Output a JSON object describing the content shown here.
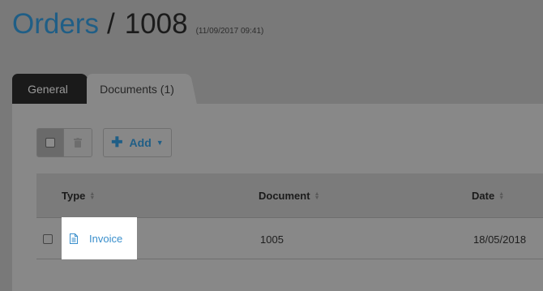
{
  "breadcrumb": {
    "parent": "Orders",
    "separator": "/",
    "current": "1008",
    "timestamp": "(11/09/2017 09:41)"
  },
  "tabs": [
    {
      "label": "General",
      "active": false
    },
    {
      "label": "Documents (1)",
      "active": true
    }
  ],
  "toolbar": {
    "add_label": "Add",
    "icons": [
      "checkbox-icon",
      "trash-icon",
      "plus-icon",
      "caret-down-icon"
    ]
  },
  "table": {
    "columns": [
      "Type",
      "Document",
      "Date"
    ],
    "rows": [
      {
        "type": "Invoice",
        "document": "1005",
        "date": "18/05/2018"
      }
    ]
  },
  "colors": {
    "link": "#3a8fcc",
    "highlight": "#ffffff",
    "overlay": "#797979"
  }
}
